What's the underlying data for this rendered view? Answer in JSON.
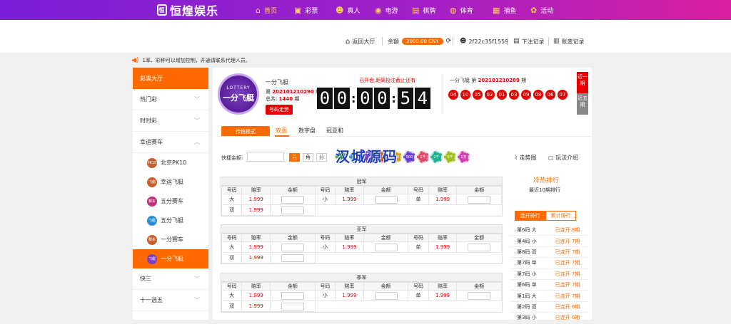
{
  "topnav": {
    "logo": "恒煌娱乐",
    "logo_badge": "恒",
    "items": [
      {
        "label": "首页",
        "icon": "home-icon",
        "glyph": "⌂"
      },
      {
        "label": "彩票",
        "icon": "lottery-icon",
        "glyph": "▣"
      },
      {
        "label": "真人",
        "icon": "person-icon",
        "glyph": "☻"
      },
      {
        "label": "电游",
        "icon": "gamepad-icon",
        "glyph": "◉"
      },
      {
        "label": "棋牌",
        "icon": "cards-icon",
        "glyph": "▤"
      },
      {
        "label": "体育",
        "icon": "ball-icon",
        "glyph": "◍"
      },
      {
        "label": "捕鱼",
        "icon": "fish-icon",
        "glyph": "▦"
      },
      {
        "label": "活动",
        "icon": "gift-icon",
        "glyph": "✿"
      }
    ]
  },
  "header": {
    "back_lobby": "返回大厅",
    "balance_label": "余额",
    "balance": "2000.00 CNY",
    "username": "2f22c35f1559",
    "bet_record": "下注记录",
    "account_record": "账变记录"
  },
  "notice": "1率、彩种可以增加控制，开通请联系代理人员。",
  "sidebar": {
    "head": "彩票大厅",
    "cats_top": [
      "热门彩",
      "时时彩",
      "幸运赛车"
    ],
    "subs": [
      {
        "label": "北京PK10",
        "color": "#c8602e",
        "tag": "PK10"
      },
      {
        "label": "幸运飞艇",
        "color": "#c8602e",
        "tag": "飞艇"
      },
      {
        "label": "五分赛车",
        "color": "#c0307a",
        "tag": "赛车"
      },
      {
        "label": "五分飞艇",
        "color": "#2c8ed6",
        "tag": "飞艇"
      },
      {
        "label": "一分赛车",
        "color": "#c8602e",
        "tag": "赛车"
      },
      {
        "label": "一分飞艇",
        "color": "#7a3fc2",
        "tag": "飞艇"
      }
    ],
    "cats_bottom": [
      "快三",
      "十一选五"
    ]
  },
  "lottery": {
    "logo_top": "LOTTERY",
    "logo_main": "一分飞艇",
    "name": "一分飞艇",
    "period_prefix": "第",
    "period": "202101210290",
    "period_suffix": "期",
    "total_label": "总共:",
    "total": "1440",
    "total_suffix": "期",
    "trend_button": "号码走势",
    "stop_text": "已开盘,距离投注截止还有",
    "countdown": [
      "0",
      "0",
      "0",
      "0",
      "5",
      "4"
    ],
    "prev_label": "一分飞艇 第",
    "prev_period": "202101210289",
    "prev_suffix": "期",
    "balls": [
      "04",
      "10",
      "05",
      "02",
      "01",
      "03",
      "09",
      "08",
      "06",
      "07"
    ],
    "recent_1": "近一期",
    "recent_5": "近五期"
  },
  "tabs": {
    "mode": "传统模式",
    "items": [
      "双面",
      "数字盘",
      "冠亚和"
    ]
  },
  "quick": {
    "label": "快捷金额:",
    "units": [
      "元",
      "角",
      "分"
    ],
    "chips": [
      {
        "label": "",
        "color": "#3c9a3c"
      },
      {
        "label": "",
        "color": "#2c8ed6"
      },
      {
        "label": "",
        "color": "#7a3fc2"
      },
      {
        "label": "",
        "color": "#c8602e"
      },
      {
        "label": "200",
        "color": "#d4a017"
      },
      {
        "label": "500",
        "color": "#6a3fd0"
      },
      {
        "label": "1千",
        "color": "#e04a6a"
      },
      {
        "label": "2千",
        "color": "#20b090"
      },
      {
        "label": "5千",
        "color": "#a0c020"
      },
      {
        "label": "1万",
        "color": "#d040b0"
      }
    ],
    "watermark": "汉城源码",
    "trend_chart": "走势图",
    "rules": "玩法介绍"
  },
  "table_headers": [
    "号码",
    "赔率",
    "金额"
  ],
  "groups": [
    {
      "title": "冠军",
      "rows": [
        [
          [
            "大",
            "1.999"
          ],
          [
            "小",
            "1.999"
          ],
          [
            "单",
            "1.999"
          ]
        ],
        [
          [
            "双",
            "1.999"
          ]
        ]
      ]
    },
    {
      "title": "亚军",
      "rows": [
        [
          [
            "大",
            "1.999"
          ],
          [
            "小",
            "1.999"
          ],
          [
            "单",
            "1.999"
          ]
        ],
        [
          [
            "双",
            "1.999"
          ]
        ]
      ]
    },
    {
      "title": "季军",
      "rows": [
        [
          [
            "大",
            "1.999"
          ],
          [
            "小",
            "1.999"
          ],
          [
            "单",
            "1.999"
          ]
        ],
        [
          [
            "双",
            "1.999"
          ]
        ]
      ]
    }
  ],
  "ranking": {
    "title": "冷热排行",
    "subtitle": "最近10期排行",
    "tab_active": "连开排行",
    "tab_inactive": "累计排行",
    "rows": [
      [
        "第6码 大",
        "已连开 8期"
      ],
      [
        "第4码 小",
        "已连开 7期"
      ],
      [
        "第8码 双",
        "已连开 7期"
      ],
      [
        "第7码 单",
        "已连开 7期"
      ],
      [
        "第7码 小",
        "已连开 7期"
      ],
      [
        "第6码 单",
        "已连开 7期"
      ],
      [
        "第1码 大",
        "已连开 7期"
      ],
      [
        "第2码 双",
        "已连开 6期"
      ],
      [
        "第3码 小",
        "已连开 6期"
      ]
    ]
  }
}
